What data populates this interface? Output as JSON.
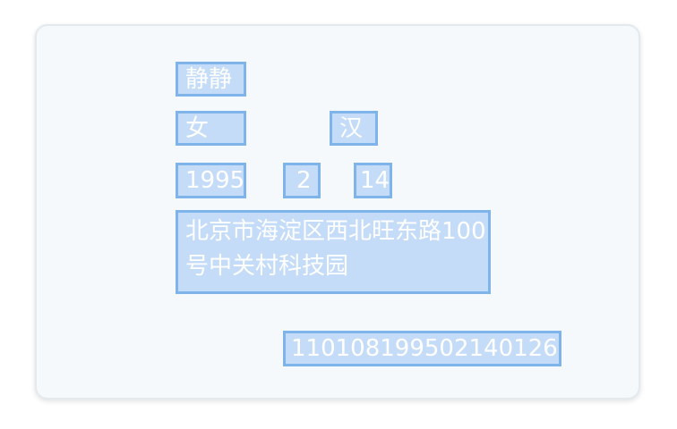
{
  "id_card": {
    "fields": {
      "name": "静静",
      "gender": "女",
      "ethnicity": "汉",
      "birth_year": "1995",
      "birth_month": "2",
      "birth_day": "14",
      "address": "北京市海淀区西北旺东路100号中关村科技园",
      "id_number": "110108199502140126"
    }
  },
  "colors": {
    "card_background": "#f6f9fb",
    "highlight_fill": "#c5dcf8",
    "highlight_border": "#7eb4ea",
    "field_text": "#ffffff"
  }
}
